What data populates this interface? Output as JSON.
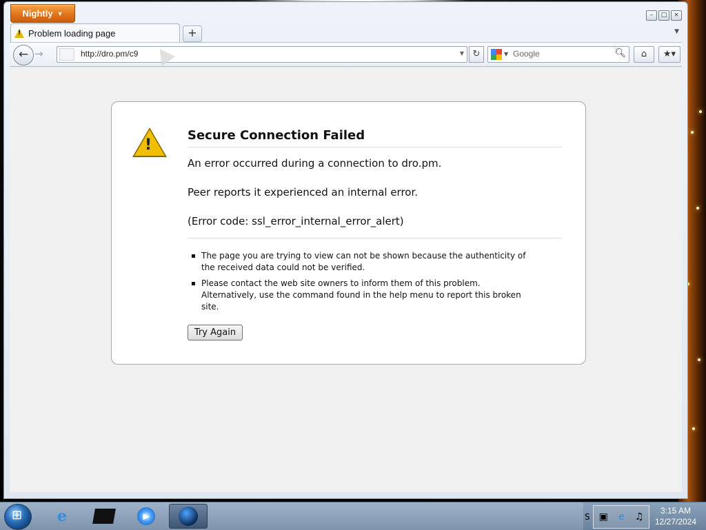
{
  "browser": {
    "app_button": "Nightly",
    "tab_title": "Problem loading page",
    "url": "http://dro.pm/c9",
    "search_placeholder": "Google"
  },
  "error_page": {
    "title": "Secure Connection Failed",
    "line1": "An error occurred during a connection to dro.pm.",
    "line2": "Peer reports it experienced an internal error.",
    "line3": "(Error code: ssl_error_internal_error_alert)",
    "bullets": [
      "The page you are trying to view can not be shown because the authenticity of the received data could not be verified.",
      "Please contact the web site owners to inform them of this problem. Alternatively, use the command found in the help menu to report this broken site."
    ],
    "try_again_label": "Try Again"
  },
  "taskbar": {
    "tray_letter": "S",
    "time": "3:15 AM",
    "date": "12/27/2024"
  },
  "icons": [
    "warning-icon",
    "back-icon",
    "forward-icon",
    "reload-icon",
    "google-icon",
    "search-icon",
    "home-icon",
    "bookmarks-icon",
    "start-icon",
    "ie-icon",
    "media-player-icon",
    "globe-icon"
  ],
  "colors": {
    "app_button": "#e2741a",
    "warning": "#f0c000",
    "taskbar": "#8aa2bb"
  }
}
